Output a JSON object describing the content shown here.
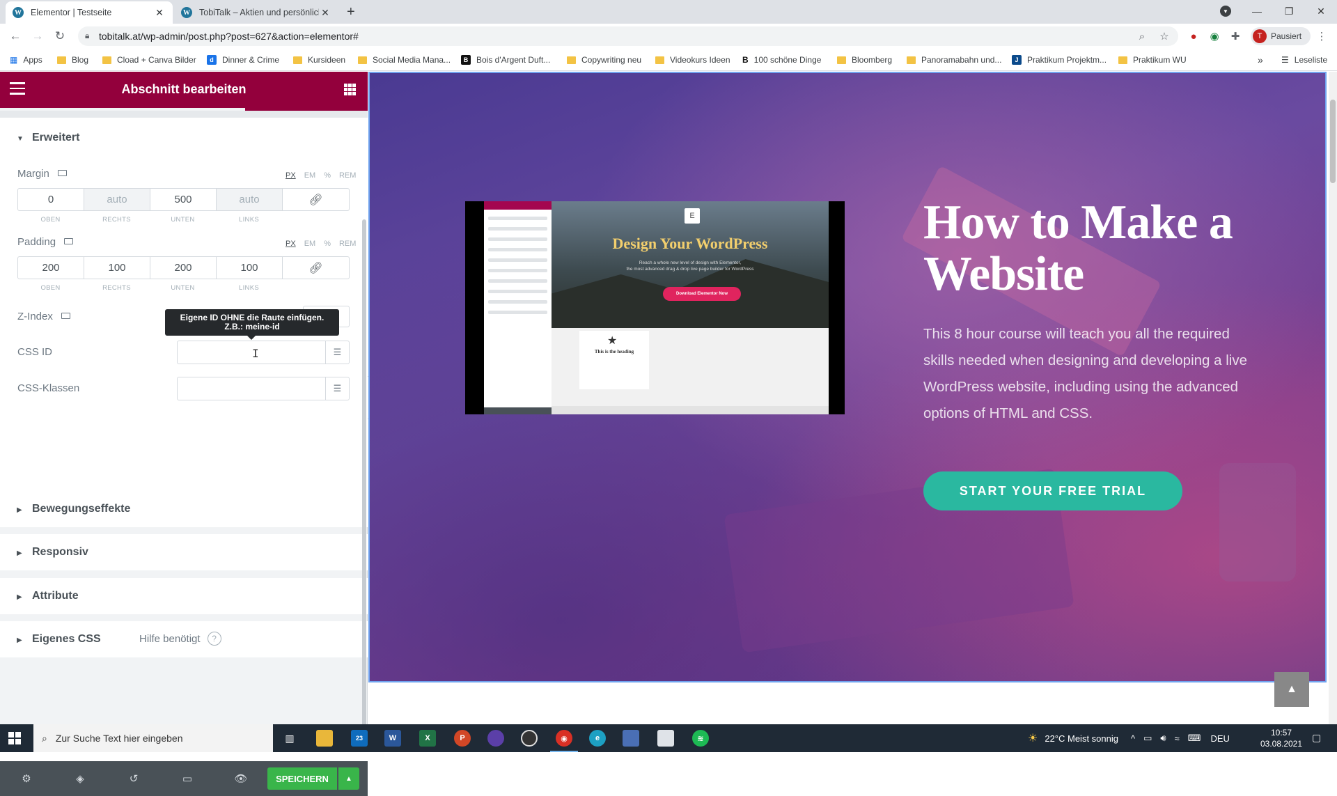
{
  "browser": {
    "tabs": [
      {
        "title": "Elementor | Testseite",
        "active": true
      },
      {
        "title": "TobiTalk – Aktien und persönliche…",
        "active": false
      }
    ],
    "url": "tobitalk.at/wp-admin/post.php?post=627&action=elementor#",
    "profile_label": "Pausiert",
    "profile_initial": "T",
    "bookmarks": [
      "Apps",
      "Blog",
      "Cload + Canva Bilder",
      "Dinner & Crime",
      "Kursideen",
      "Social Media Mana...",
      "Bois d'Argent Duft...",
      "Copywriting neu",
      "Videokurs Ideen",
      "100 schöne Dinge",
      "Bloomberg",
      "Panoramabahn und...",
      "Praktikum Projektm...",
      "Praktikum WU"
    ],
    "reading_list": "Leseliste"
  },
  "panel": {
    "header_title": "Abschnitt bearbeiten",
    "section_title": "Erweitert",
    "margin": {
      "label": "Margin",
      "units": [
        "PX",
        "EM",
        "%",
        "REM"
      ],
      "top": "0",
      "right_placeholder": "auto",
      "bottom": "500",
      "left_placeholder": "auto",
      "sub_labels": [
        "OBEN",
        "RECHTS",
        "UNTEN",
        "LINKS"
      ]
    },
    "padding": {
      "label": "Padding",
      "units": [
        "PX",
        "EM",
        "%",
        "REM"
      ],
      "top": "200",
      "right": "100",
      "bottom": "200",
      "left": "100",
      "sub_labels": [
        "OBEN",
        "RECHTS",
        "UNTEN",
        "LINKS"
      ]
    },
    "zindex_label": "Z-Index",
    "tooltip_line1": "Eigene ID OHNE die Raute einfügen.",
    "tooltip_line2": "Z.B.: meine-id",
    "css_id_label": "CSS ID",
    "css_classes_label": "CSS-Klassen",
    "collapsed_sections": [
      "Bewegungseffekte",
      "Responsiv",
      "Attribute",
      "Eigenes CSS"
    ],
    "help_label": "Hilfe benötigt",
    "save_label": "SPEICHERN"
  },
  "preview": {
    "video": {
      "title": "Design Your WordPress",
      "subtitle_1": "Reach a whole new level of design with Elementor,",
      "subtitle_2": "the most advanced drag & drop live page builder for WordPress",
      "button": "Download Elementor Now",
      "heading": "This is the heading"
    },
    "hero_title": "How to Make a Website",
    "hero_description": "This 8 hour course will teach you all the required skills needed when designing and developing a live WordPress website, including using the advanced options of HTML and CSS.",
    "cta_label": "START YOUR FREE TRIAL"
  },
  "taskbar": {
    "search_placeholder": "Zur Suche Text hier eingeben",
    "weather": "22°C  Meist sonnig",
    "language": "DEU",
    "time": "10:57",
    "date": "03.08.2021",
    "mail_badge": "23"
  }
}
